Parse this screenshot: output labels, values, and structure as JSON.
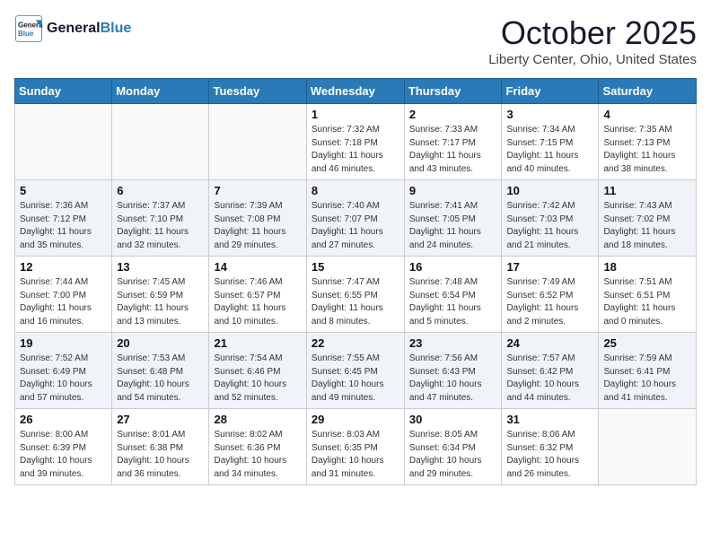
{
  "header": {
    "logo_line1": "General",
    "logo_line2": "Blue",
    "month": "October 2025",
    "location": "Liberty Center, Ohio, United States"
  },
  "weekdays": [
    "Sunday",
    "Monday",
    "Tuesday",
    "Wednesday",
    "Thursday",
    "Friday",
    "Saturday"
  ],
  "weeks": [
    [
      {
        "day": "",
        "info": ""
      },
      {
        "day": "",
        "info": ""
      },
      {
        "day": "",
        "info": ""
      },
      {
        "day": "1",
        "info": "Sunrise: 7:32 AM\nSunset: 7:18 PM\nDaylight: 11 hours\nand 46 minutes."
      },
      {
        "day": "2",
        "info": "Sunrise: 7:33 AM\nSunset: 7:17 PM\nDaylight: 11 hours\nand 43 minutes."
      },
      {
        "day": "3",
        "info": "Sunrise: 7:34 AM\nSunset: 7:15 PM\nDaylight: 11 hours\nand 40 minutes."
      },
      {
        "day": "4",
        "info": "Sunrise: 7:35 AM\nSunset: 7:13 PM\nDaylight: 11 hours\nand 38 minutes."
      }
    ],
    [
      {
        "day": "5",
        "info": "Sunrise: 7:36 AM\nSunset: 7:12 PM\nDaylight: 11 hours\nand 35 minutes."
      },
      {
        "day": "6",
        "info": "Sunrise: 7:37 AM\nSunset: 7:10 PM\nDaylight: 11 hours\nand 32 minutes."
      },
      {
        "day": "7",
        "info": "Sunrise: 7:39 AM\nSunset: 7:08 PM\nDaylight: 11 hours\nand 29 minutes."
      },
      {
        "day": "8",
        "info": "Sunrise: 7:40 AM\nSunset: 7:07 PM\nDaylight: 11 hours\nand 27 minutes."
      },
      {
        "day": "9",
        "info": "Sunrise: 7:41 AM\nSunset: 7:05 PM\nDaylight: 11 hours\nand 24 minutes."
      },
      {
        "day": "10",
        "info": "Sunrise: 7:42 AM\nSunset: 7:03 PM\nDaylight: 11 hours\nand 21 minutes."
      },
      {
        "day": "11",
        "info": "Sunrise: 7:43 AM\nSunset: 7:02 PM\nDaylight: 11 hours\nand 18 minutes."
      }
    ],
    [
      {
        "day": "12",
        "info": "Sunrise: 7:44 AM\nSunset: 7:00 PM\nDaylight: 11 hours\nand 16 minutes."
      },
      {
        "day": "13",
        "info": "Sunrise: 7:45 AM\nSunset: 6:59 PM\nDaylight: 11 hours\nand 13 minutes."
      },
      {
        "day": "14",
        "info": "Sunrise: 7:46 AM\nSunset: 6:57 PM\nDaylight: 11 hours\nand 10 minutes."
      },
      {
        "day": "15",
        "info": "Sunrise: 7:47 AM\nSunset: 6:55 PM\nDaylight: 11 hours\nand 8 minutes."
      },
      {
        "day": "16",
        "info": "Sunrise: 7:48 AM\nSunset: 6:54 PM\nDaylight: 11 hours\nand 5 minutes."
      },
      {
        "day": "17",
        "info": "Sunrise: 7:49 AM\nSunset: 6:52 PM\nDaylight: 11 hours\nand 2 minutes."
      },
      {
        "day": "18",
        "info": "Sunrise: 7:51 AM\nSunset: 6:51 PM\nDaylight: 11 hours\nand 0 minutes."
      }
    ],
    [
      {
        "day": "19",
        "info": "Sunrise: 7:52 AM\nSunset: 6:49 PM\nDaylight: 10 hours\nand 57 minutes."
      },
      {
        "day": "20",
        "info": "Sunrise: 7:53 AM\nSunset: 6:48 PM\nDaylight: 10 hours\nand 54 minutes."
      },
      {
        "day": "21",
        "info": "Sunrise: 7:54 AM\nSunset: 6:46 PM\nDaylight: 10 hours\nand 52 minutes."
      },
      {
        "day": "22",
        "info": "Sunrise: 7:55 AM\nSunset: 6:45 PM\nDaylight: 10 hours\nand 49 minutes."
      },
      {
        "day": "23",
        "info": "Sunrise: 7:56 AM\nSunset: 6:43 PM\nDaylight: 10 hours\nand 47 minutes."
      },
      {
        "day": "24",
        "info": "Sunrise: 7:57 AM\nSunset: 6:42 PM\nDaylight: 10 hours\nand 44 minutes."
      },
      {
        "day": "25",
        "info": "Sunrise: 7:59 AM\nSunset: 6:41 PM\nDaylight: 10 hours\nand 41 minutes."
      }
    ],
    [
      {
        "day": "26",
        "info": "Sunrise: 8:00 AM\nSunset: 6:39 PM\nDaylight: 10 hours\nand 39 minutes."
      },
      {
        "day": "27",
        "info": "Sunrise: 8:01 AM\nSunset: 6:38 PM\nDaylight: 10 hours\nand 36 minutes."
      },
      {
        "day": "28",
        "info": "Sunrise: 8:02 AM\nSunset: 6:36 PM\nDaylight: 10 hours\nand 34 minutes."
      },
      {
        "day": "29",
        "info": "Sunrise: 8:03 AM\nSunset: 6:35 PM\nDaylight: 10 hours\nand 31 minutes."
      },
      {
        "day": "30",
        "info": "Sunrise: 8:05 AM\nSunset: 6:34 PM\nDaylight: 10 hours\nand 29 minutes."
      },
      {
        "day": "31",
        "info": "Sunrise: 8:06 AM\nSunset: 6:32 PM\nDaylight: 10 hours\nand 26 minutes."
      },
      {
        "day": "",
        "info": ""
      }
    ]
  ]
}
